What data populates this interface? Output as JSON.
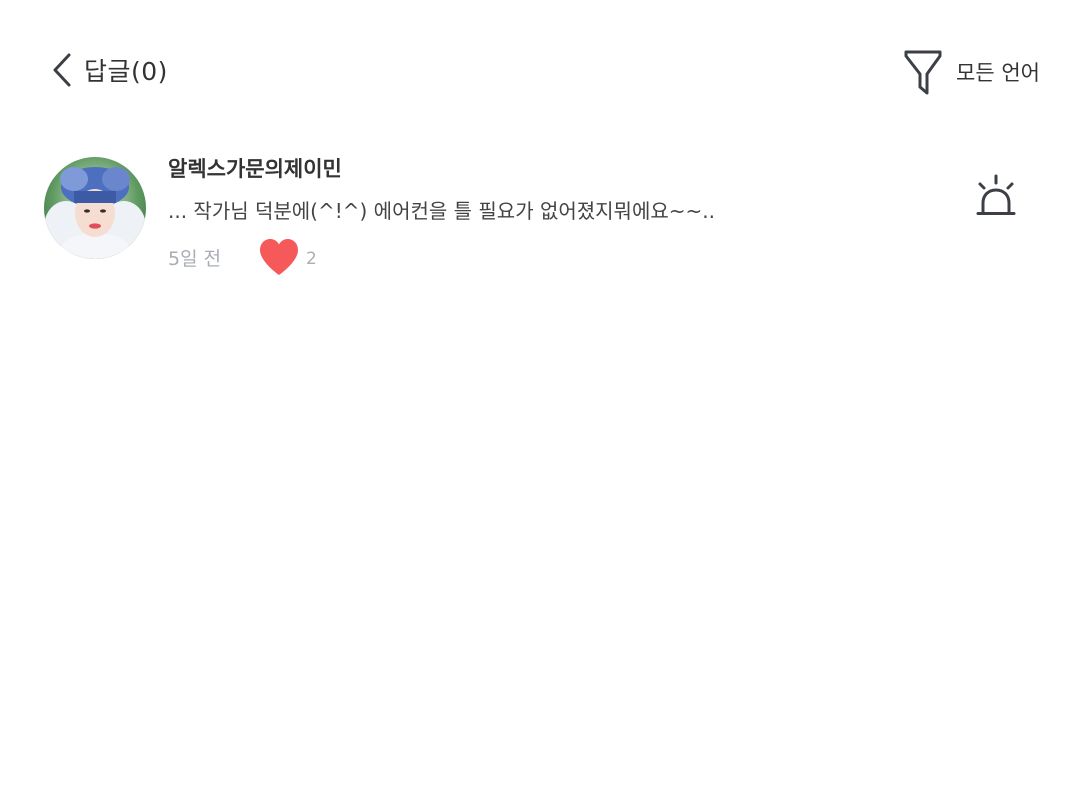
{
  "header": {
    "title": "답글(0)",
    "back_icon": "chevron-left-icon",
    "filter_icon": "funnel-icon",
    "filter_label": "모든 언어"
  },
  "comments": [
    {
      "username": "알렉스가문의제이민",
      "text": "... 작가님 덕분에(^!^) 에어컨을 틀 필요가 없어졌지뭐에요~~..",
      "timestamp": "5일 전",
      "likes": "2",
      "like_icon": "heart-icon",
      "report_icon": "siren-icon"
    }
  ],
  "colors": {
    "text_primary": "#333333",
    "text_muted": "#a9aeb4",
    "heart": "#f5595a",
    "icon": "#3c4046"
  }
}
